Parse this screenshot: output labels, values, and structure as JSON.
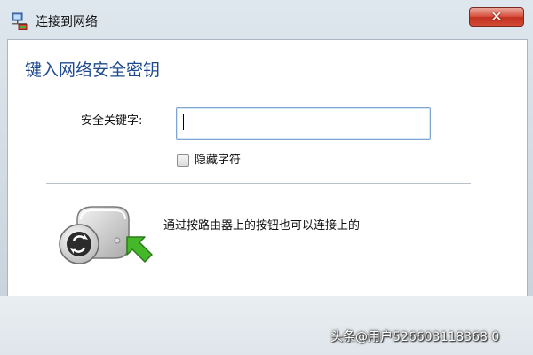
{
  "window": {
    "title": "连接到网络",
    "close_glyph": "✕"
  },
  "dialog": {
    "heading": "键入网络安全密钥",
    "key_label": "安全关键字:",
    "key_value": "",
    "hide_chars_label": "隐藏字符",
    "hide_chars_checked": false,
    "router_text": "通过按路由器上的按钮也可以连接上的"
  },
  "icons": {
    "title": "network-icon",
    "close": "close-icon",
    "router": "wps-router-icon",
    "arrow": "green-arrow-icon"
  },
  "colors": {
    "heading": "#1d4a8f",
    "close_button": "#c2311f",
    "arrow": "#45b82a"
  },
  "watermark": "头条@用户526603118368   0"
}
